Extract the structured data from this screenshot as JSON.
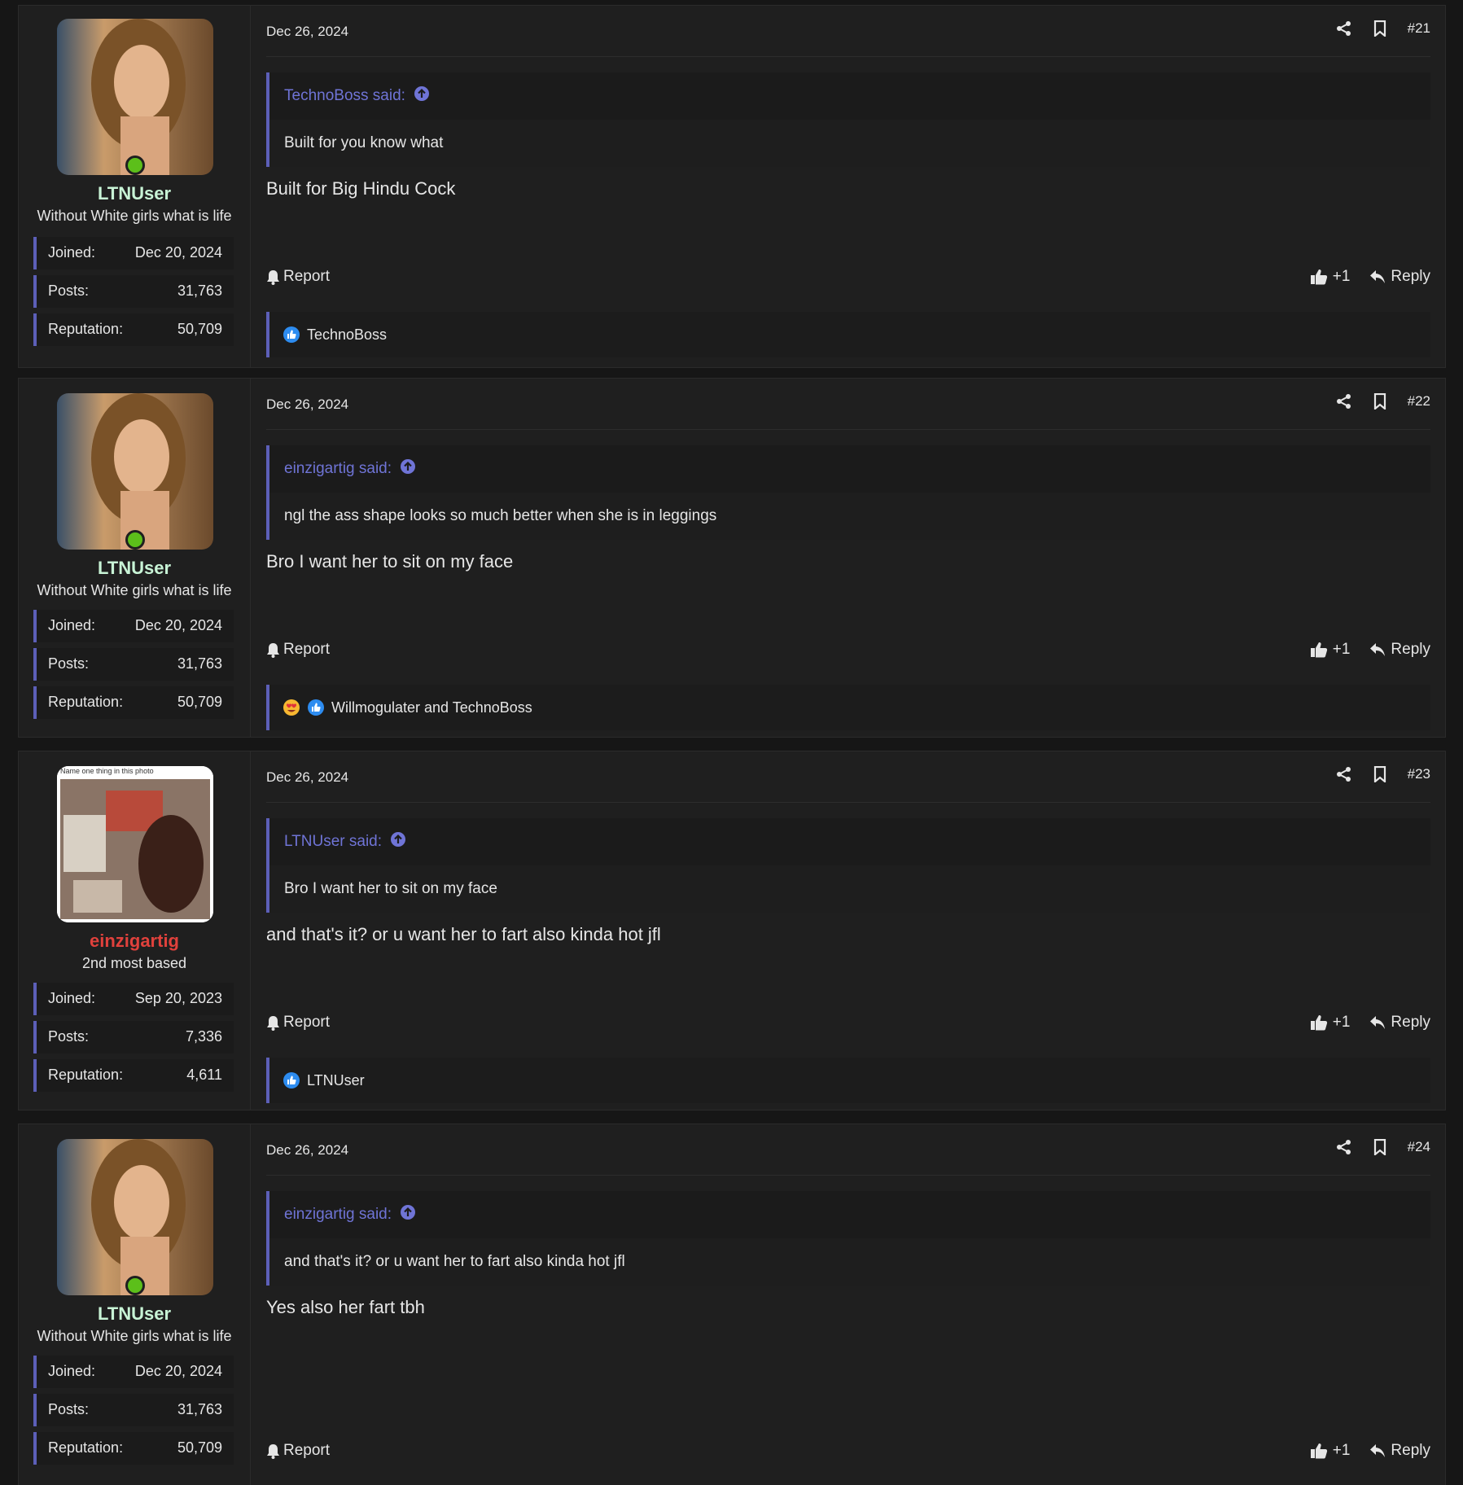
{
  "posts": [
    {
      "user": {
        "name": "LTNUser",
        "name_color": "#c8f4d6",
        "title": "Without White girls what is life",
        "online": true,
        "joined_label": "Joined:",
        "joined": "Dec 20, 2024",
        "posts_label": "Posts:",
        "posts": "31,763",
        "rep_label": "Reputation:",
        "rep": "50,709"
      },
      "date": "Dec 26, 2024",
      "number": "#21",
      "quote": {
        "author_line": "TechnoBoss said:",
        "text": "Built for you know what"
      },
      "message": "Built for Big Hindu Cock",
      "report_label": "Report",
      "like_label": "+1",
      "reply_label": "Reply",
      "reactions": "TechnoBoss"
    },
    {
      "user": {
        "name": "LTNUser",
        "name_color": "#c8f4d6",
        "title": "Without White girls what is life",
        "online": true,
        "joined_label": "Joined:",
        "joined": "Dec 20, 2024",
        "posts_label": "Posts:",
        "posts": "31,763",
        "rep_label": "Reputation:",
        "rep": "50,709"
      },
      "date": "Dec 26, 2024",
      "number": "#22",
      "quote": {
        "author_line": "einzigartig said:",
        "text": "ngl the ass shape looks so much better when she is in leggings"
      },
      "message": "Bro I want her to sit on my face",
      "report_label": "Report",
      "like_label": "+1",
      "reply_label": "Reply",
      "reactions": "Willmogulater and TechnoBoss"
    },
    {
      "user": {
        "name": "einzigartig",
        "name_color": "#e0413c",
        "title": "2nd most based",
        "online": false,
        "avatar_caption": "Name one thing in this photo",
        "joined_label": "Joined:",
        "joined": "Sep 20, 2023",
        "posts_label": "Posts:",
        "posts": "7,336",
        "rep_label": "Reputation:",
        "rep": "4,611"
      },
      "date": "Dec 26, 2024",
      "number": "#23",
      "quote": {
        "author_line": "LTNUser said:",
        "text": "Bro I want her to sit on my face"
      },
      "message": "and that's it? or u want her to fart also kinda hot jfl",
      "report_label": "Report",
      "like_label": "+1",
      "reply_label": "Reply",
      "reactions": "LTNUser"
    },
    {
      "user": {
        "name": "LTNUser",
        "name_color": "#c8f4d6",
        "title": "Without White girls what is life",
        "online": true,
        "joined_label": "Joined:",
        "joined": "Dec 20, 2024",
        "posts_label": "Posts:",
        "posts": "31,763",
        "rep_label": "Reputation:",
        "rep": "50,709"
      },
      "date": "Dec 26, 2024",
      "number": "#24",
      "quote": {
        "author_line": "einzigartig said:",
        "text": "and that's it? or u want her to fart also kinda hot jfl"
      },
      "message": "Yes also her fart tbh",
      "report_label": "Report",
      "like_label": "+1",
      "reply_label": "Reply"
    }
  ],
  "colors": {
    "accent": "#5c5fb8",
    "quote_author": "#6f74d6",
    "online": "#5cbf1a",
    "like_blue": "#2d8cf0"
  },
  "icons": [
    "share-icon",
    "bookmark-icon",
    "arrow-up-circle-icon",
    "bell-icon",
    "thumbs-up-icon",
    "reply-icon",
    "like-reaction-icon",
    "love-reaction-icon"
  ]
}
